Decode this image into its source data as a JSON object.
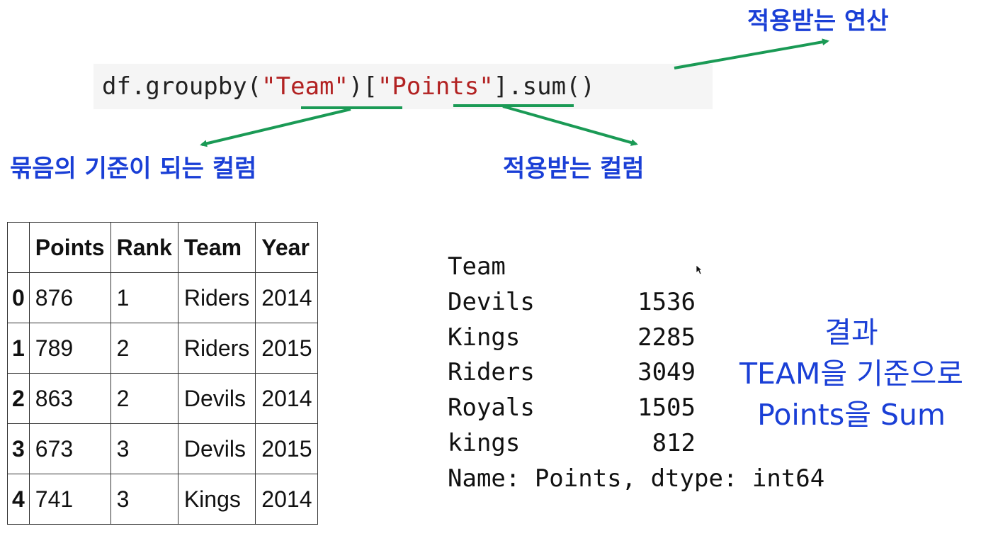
{
  "code": {
    "prefix": "df.groupby(",
    "group_key": "\"Team\"",
    "mid": ")[",
    "column": "\"Points\"",
    "suffix": "].sum()"
  },
  "annotations": {
    "operation": "적용받는 연산",
    "group_column": "묶음의 기준이 되는 컬럼",
    "applied_column": "적용받는 컬럼",
    "result_line1": "결과",
    "result_line2": "TEAM을 기준으로",
    "result_line3": "Points을 Sum"
  },
  "colors": {
    "arrow": "#1a9a55",
    "annotation_text": "#1a3fd6",
    "code_string": "#b22222"
  },
  "dataframe": {
    "columns": [
      "",
      "Points",
      "Rank",
      "Team",
      "Year"
    ],
    "rows": [
      [
        "0",
        "876",
        "1",
        "Riders",
        "2014"
      ],
      [
        "1",
        "789",
        "2",
        "Riders",
        "2015"
      ],
      [
        "2",
        "863",
        "2",
        "Devils",
        "2014"
      ],
      [
        "3",
        "673",
        "3",
        "Devils",
        "2015"
      ],
      [
        "4",
        "741",
        "3",
        "Kings",
        "2014"
      ]
    ]
  },
  "series": {
    "index_name": "Team",
    "items": [
      {
        "team": "Devils",
        "value": "1536"
      },
      {
        "team": "Kings",
        "value": "2285"
      },
      {
        "team": "Riders",
        "value": "3049"
      },
      {
        "team": "Royals",
        "value": "1505"
      },
      {
        "team": "kings",
        "value": "812"
      }
    ],
    "footer": "Name: Points, dtype: int64"
  }
}
